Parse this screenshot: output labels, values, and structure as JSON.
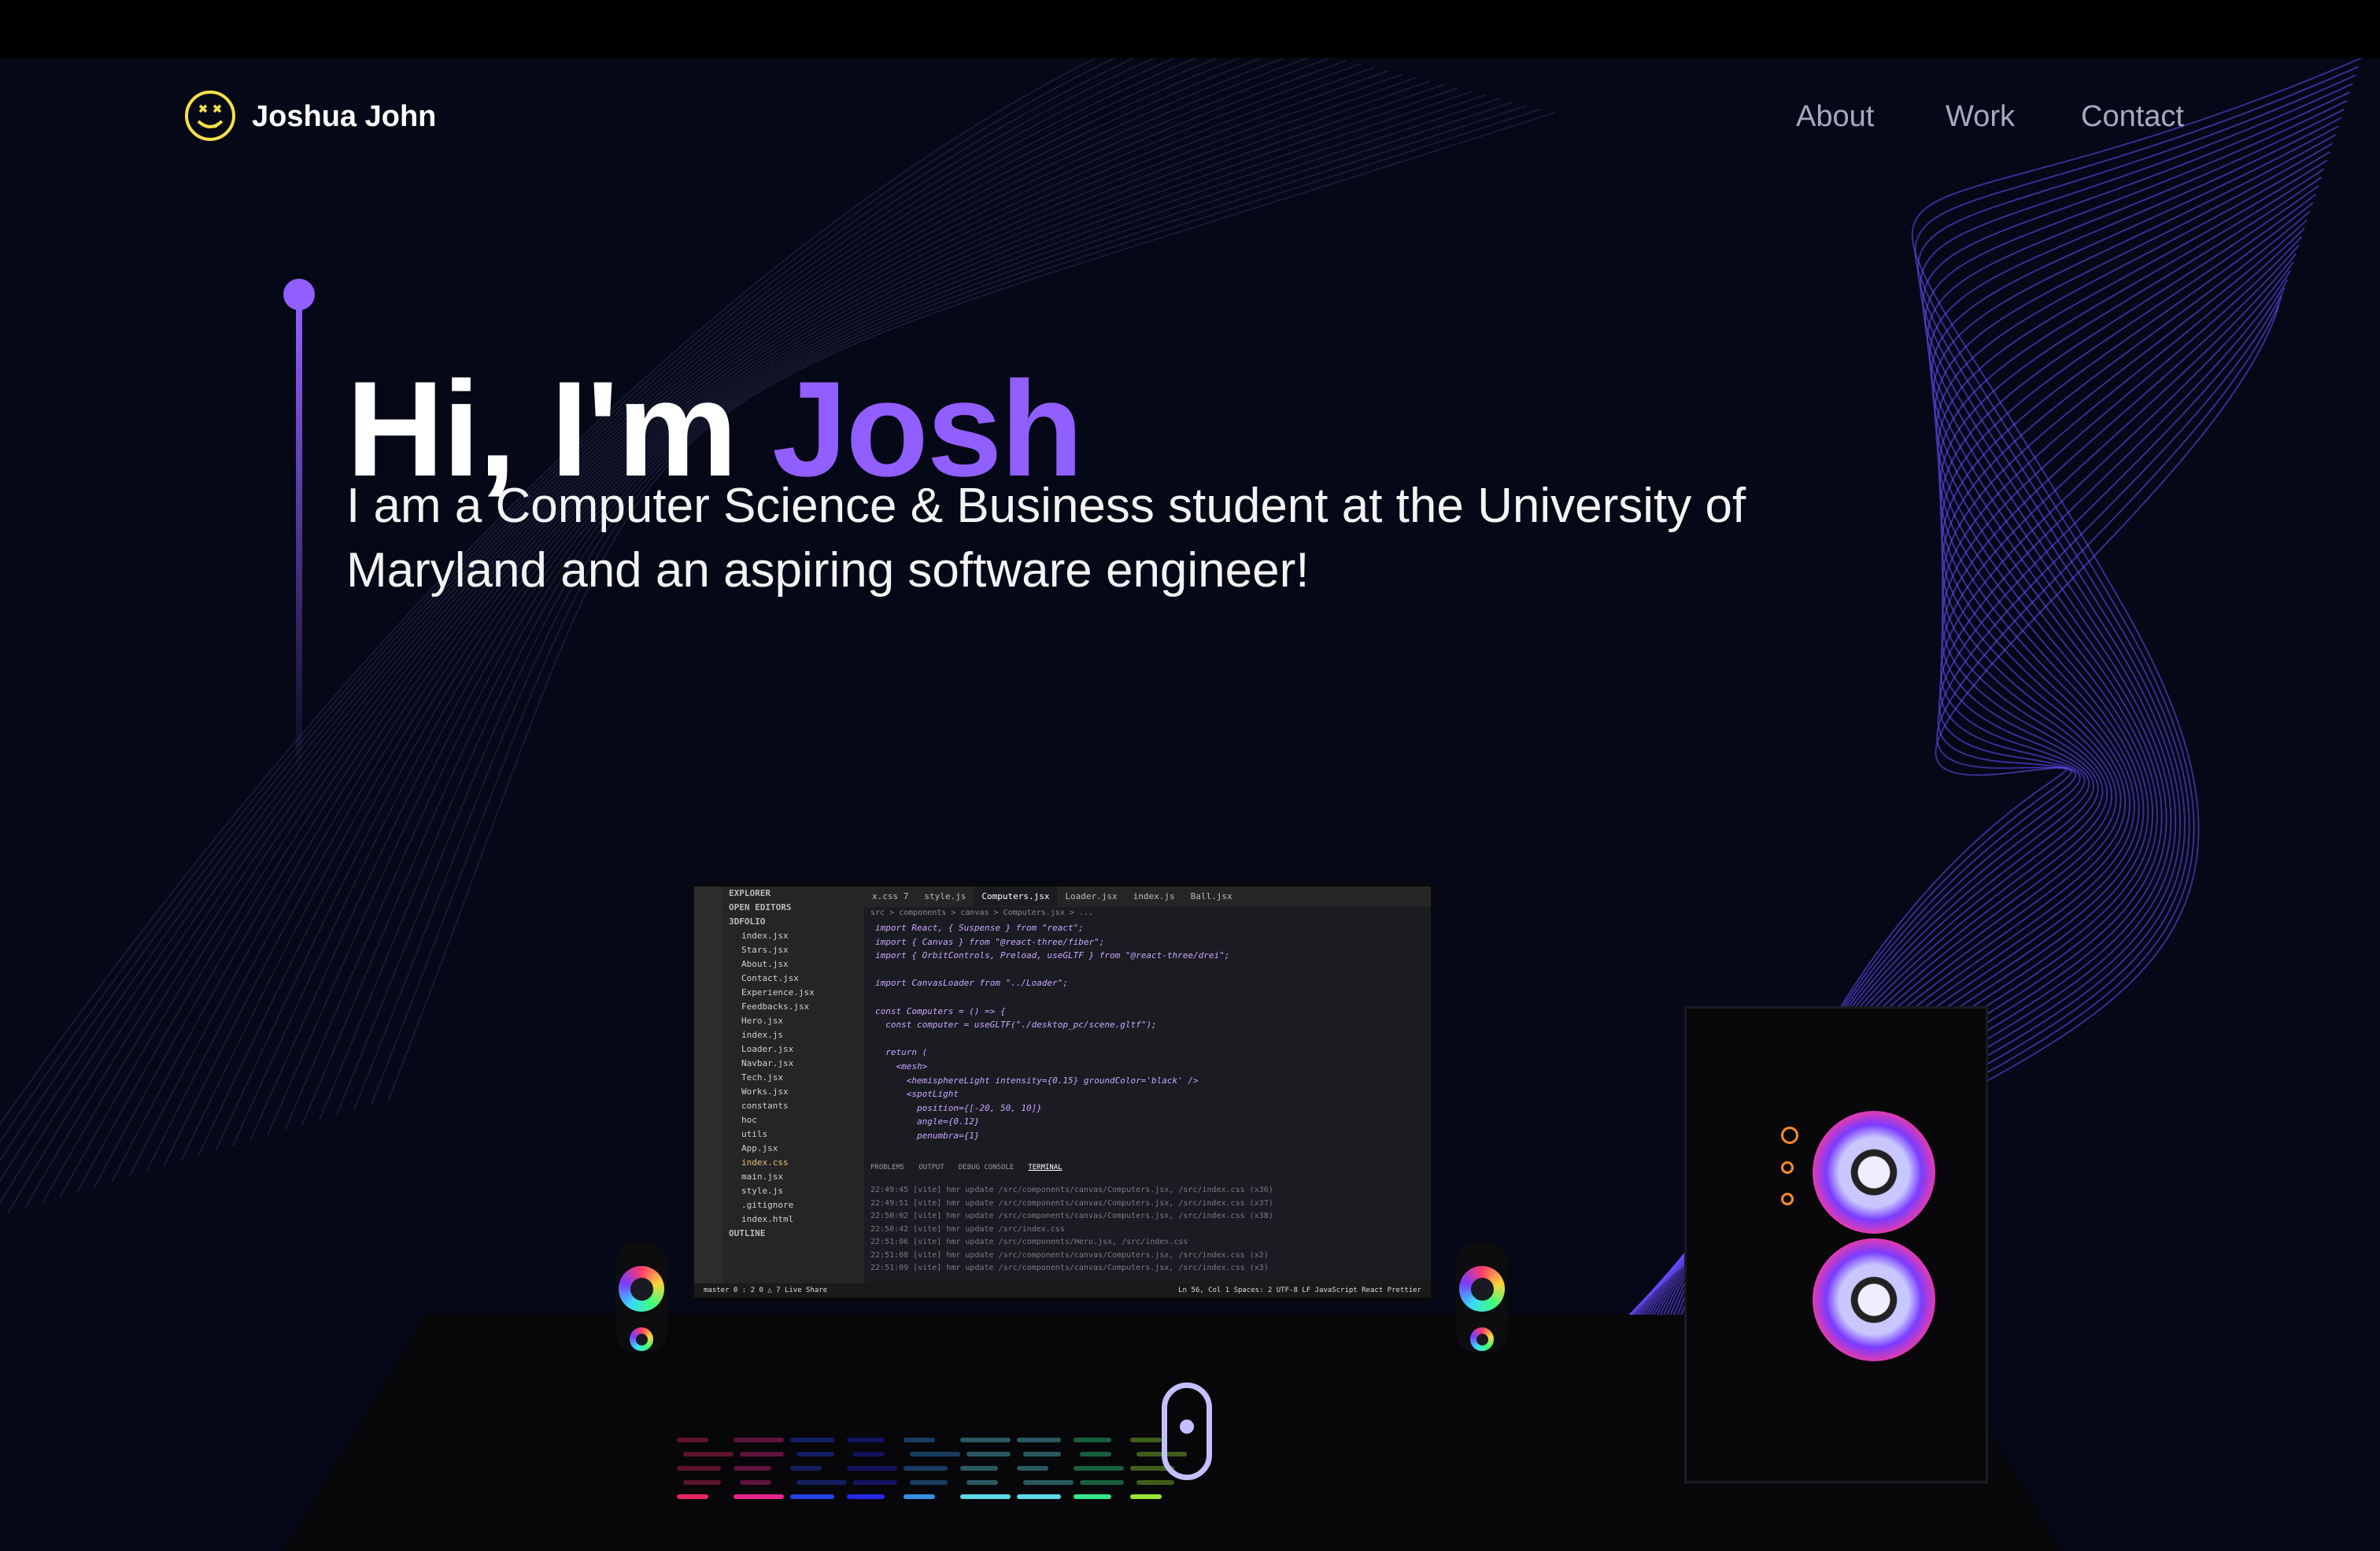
{
  "navbar": {
    "brand": "Joshua John",
    "links": [
      "About",
      "Work",
      "Contact"
    ]
  },
  "hero": {
    "greeting": "Hi, I'm ",
    "name": "Josh",
    "subtitle": "I am a Computer Science & Business student at the University of Maryland and an aspiring software engineer!"
  },
  "colors": {
    "background": "#050816",
    "accent": "#915eff",
    "nav_text": "#aaa6c3"
  },
  "icons": {
    "logo": "smiley-face-logo-icon",
    "mouse": "scroll-mouse-icon"
  },
  "screen": {
    "tabs": [
      "x.css 7",
      "style.js",
      "Computers.jsx",
      "Loader.jsx",
      "index.js",
      "Ball.jsx"
    ],
    "explorer_rows": [
      "EXPLORER",
      "OPEN EDITORS",
      "3DFOLIO",
      "index.jsx",
      "Stars.jsx",
      "About.jsx",
      "Contact.jsx",
      "Experience.jsx",
      "Feedbacks.jsx",
      "Hero.jsx",
      "index.js",
      "Loader.jsx",
      "Navbar.jsx",
      "Tech.jsx",
      "Works.jsx",
      "constants",
      "hoc",
      "utils",
      "App.jsx",
      "index.css",
      "main.jsx",
      "style.js",
      ".gitignore",
      "index.html",
      "OUTLINE"
    ],
    "breadcrumb": "src > components > canvas > Computers.jsx > ...",
    "code_lines": [
      "import React, { Suspense } from \"react\";",
      "import { Canvas } from \"@react-three/fiber\";",
      "import { OrbitControls, Preload, useGLTF } from \"@react-three/drei\";",
      "",
      "import CanvasLoader from \"../Loader\";",
      "",
      "const Computers = () => {",
      "  const computer = useGLTF(\"./desktop_pc/scene.gltf\");",
      "",
      "  return (",
      "    <mesh>",
      "      <hemisphereLight intensity={0.15} groundColor='black' />",
      "      <spotLight",
      "        position={[-20, 50, 10]}",
      "        angle={0.12}",
      "        penumbra={1}"
    ],
    "panel_tabs": [
      "PROBLEMS",
      "OUTPUT",
      "DEBUG CONSOLE",
      "TERMINAL"
    ],
    "terminal_lines": [
      "22:49:45 [vite] hmr update /src/components/canvas/Computers.jsx, /src/index.css (x36)",
      "22:49:51 [vite] hmr update /src/components/canvas/Computers.jsx, /src/index.css (x37)",
      "22:50:02 [vite] hmr update /src/components/canvas/Computers.jsx, /src/index.css (x38)",
      "22:50:42 [vite] hmr update /src/index.css",
      "22:51:06 [vite] hmr update /src/components/Hero.jsx, /src/index.css",
      "22:51:08 [vite] hmr update /src/components/canvas/Computers.jsx, /src/index.css (x2)",
      "22:51:09 [vite] hmr update /src/components/canvas/Computers.jsx, /src/index.css (x3)"
    ],
    "status_left": "master  0 : 2  0 △ 7  Live Share",
    "status_right": "Ln 56, Col 1   Spaces: 2   UTF-8   LF   JavaScript React   Prettier"
  }
}
